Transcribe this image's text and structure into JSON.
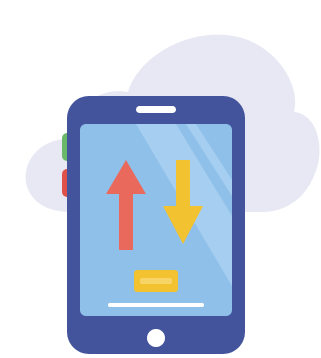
{
  "illustration": {
    "subject": "cloud-sync-phone",
    "colors": {
      "cloud": "#e8e8f4",
      "phone_frame": "#44549c",
      "screen": "#8fc0ea",
      "screen_highlight": "#a6cef0",
      "upload_arrow": "#e96a5c",
      "download_arrow": "#f2c230",
      "progress_bar": "#f2c230",
      "side_button_green": "#6ab86a",
      "side_button_red": "#e0504a",
      "speaker": "#ffffff",
      "home_button": "#ffffff"
    },
    "icons": [
      "cloud-icon",
      "smartphone-icon",
      "upload-arrow-icon",
      "download-arrow-icon",
      "progress-bar-icon"
    ]
  }
}
